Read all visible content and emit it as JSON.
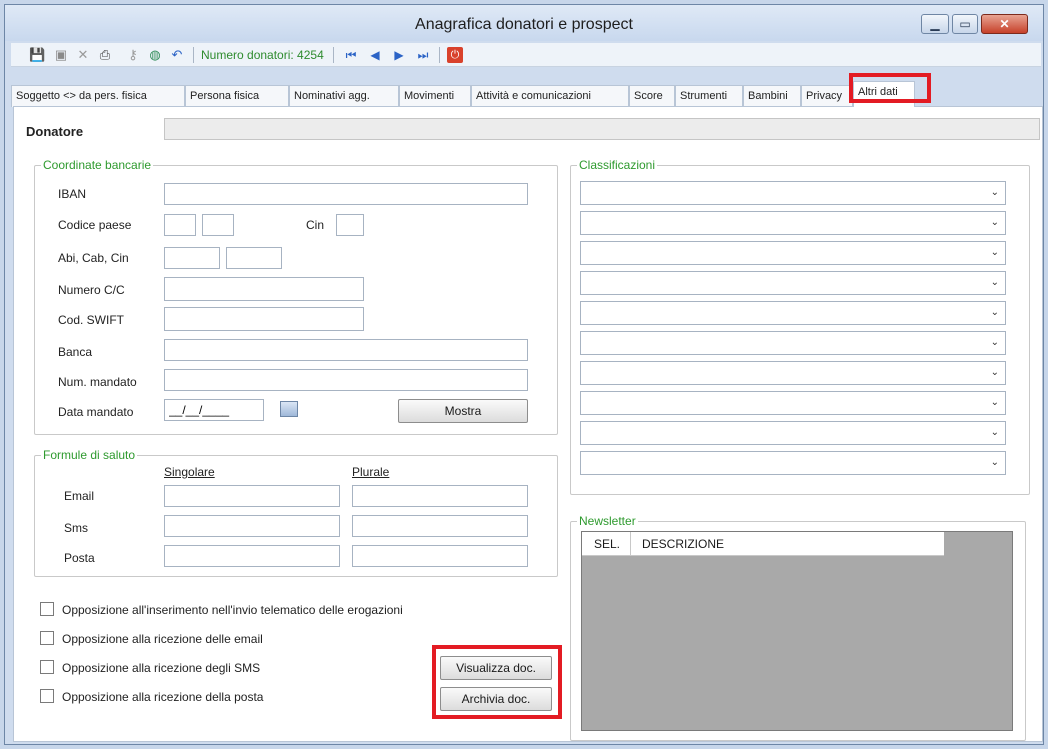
{
  "window": {
    "title": "Anagrafica donatori e prospect",
    "min_glyph": "▁",
    "max_glyph": "▭",
    "close_glyph": "✕"
  },
  "toolbar": {
    "count_text": "Numero donatori: 4254",
    "icons": [
      "save-icon",
      "lock-icon",
      "delete-icon",
      "print-icon",
      "key-icon",
      "globe-icon",
      "undo-icon",
      "first-icon",
      "prev-icon",
      "next-icon",
      "last-icon",
      "stop-icon"
    ],
    "glyphs": {
      "save": "💾",
      "lock": "▣",
      "delete": "✕",
      "print": "⎙",
      "key": "⚷",
      "globe": "◍",
      "undo": "↶",
      "first": "⏮",
      "prev": "◀",
      "next": "▶",
      "last": "⏭",
      "stop": "⏻"
    }
  },
  "tabs": [
    "Soggetto <> da pers. fisica",
    "Persona fisica",
    "Nominativi agg.",
    "Movimenti",
    "Attività e comunicazioni",
    "Score",
    "Strumenti",
    "Bambini",
    "Privacy",
    "Altri dati"
  ],
  "donatore": {
    "label": "Donatore",
    "value": ""
  },
  "bank": {
    "title": "Coordinate bancarie",
    "iban_label": "IBAN",
    "codice_paese_label": "Codice paese",
    "cin_label": "Cin",
    "abi_label": "Abi, Cab, Cin",
    "numero_cc_label": "Numero C/C",
    "swift_label": "Cod. SWIFT",
    "banca_label": "Banca",
    "num_mandato_label": "Num. mandato",
    "data_mandato_label": "Data mandato",
    "data_mandato_value": "__/__/____",
    "mostra_button": "Mostra"
  },
  "saluto": {
    "title": "Formule di saluto",
    "singolare": "Singolare",
    "plurale": "Plurale",
    "rows": [
      "Email",
      "Sms",
      "Posta"
    ]
  },
  "classificazioni": {
    "title": "Classificazioni",
    "count": 10,
    "arrow": "⌄"
  },
  "newsletter": {
    "title": "Newsletter",
    "col_sel": "SEL.",
    "col_desc": "DESCRIZIONE"
  },
  "checkboxes": [
    "Opposizione all'inserimento nell'invio telematico delle erogazioni",
    "Opposizione alla ricezione delle email",
    "Opposizione alla ricezione degli SMS",
    "Opposizione alla ricezione della posta"
  ],
  "buttons": {
    "visualizza": "Visualizza doc.",
    "archivia": "Archivia doc."
  },
  "highlight_color": "#e31b23"
}
